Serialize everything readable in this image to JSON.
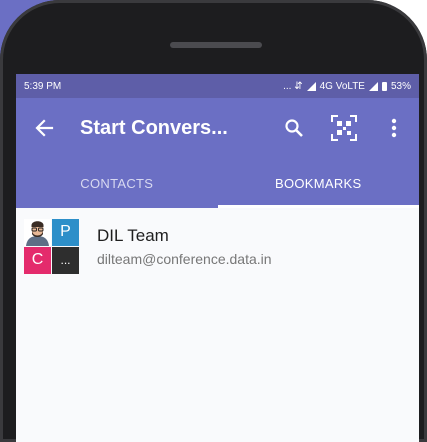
{
  "status_bar": {
    "time": "5:39 PM",
    "indicators": "... ⇵",
    "network": "4G VoLTE",
    "battery": "53%"
  },
  "app_bar": {
    "title": "Start Convers...",
    "icons": [
      "back-arrow-icon",
      "search-icon",
      "qr-code-icon",
      "more-vert-icon"
    ]
  },
  "tabs": [
    {
      "label": "CONTACTS",
      "active": false
    },
    {
      "label": "BOOKMARKS",
      "active": true
    }
  ],
  "bookmarks": [
    {
      "name": "DIL Team",
      "address": "dilteam@conference.data.in",
      "avatar": {
        "tiles": [
          "P",
          "C",
          "..."
        ]
      }
    }
  ],
  "colors": {
    "primary": "#6b6fc4",
    "status_bar": "#5e5ea8",
    "tile_blue": "#2d8fc9",
    "tile_pink": "#e42b6c"
  }
}
